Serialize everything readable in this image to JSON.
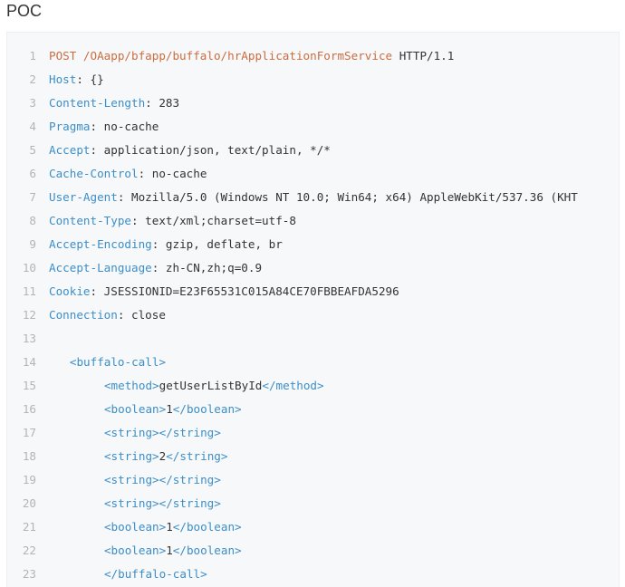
{
  "heading": "POC",
  "colors": {
    "method": "#cb6d3e",
    "key": "#3d8ec7",
    "text": "#333333",
    "line_number": "#b4b4b4",
    "background": "#f6f8fa"
  },
  "code": {
    "lines": [
      {
        "number": "1",
        "indent": 0,
        "parts": [
          {
            "t": "kw",
            "v": "POST /OAapp/bfapp/buffalo/hrApplicationFormService"
          },
          {
            "t": "txt",
            "v": " HTTP/1.1"
          }
        ]
      },
      {
        "number": "2",
        "indent": 0,
        "parts": [
          {
            "t": "hdr",
            "v": "Host"
          },
          {
            "t": "txt",
            "v": ": {}"
          }
        ]
      },
      {
        "number": "3",
        "indent": 0,
        "parts": [
          {
            "t": "hdr",
            "v": "Content-Length"
          },
          {
            "t": "txt",
            "v": ": 283"
          }
        ]
      },
      {
        "number": "4",
        "indent": 0,
        "parts": [
          {
            "t": "hdr",
            "v": "Pragma"
          },
          {
            "t": "txt",
            "v": ": no-cache"
          }
        ]
      },
      {
        "number": "5",
        "indent": 0,
        "parts": [
          {
            "t": "hdr",
            "v": "Accept"
          },
          {
            "t": "txt",
            "v": ": application/json, text/plain, */*"
          }
        ]
      },
      {
        "number": "6",
        "indent": 0,
        "parts": [
          {
            "t": "hdr",
            "v": "Cache-Control"
          },
          {
            "t": "txt",
            "v": ": no-cache"
          }
        ]
      },
      {
        "number": "7",
        "indent": 0,
        "parts": [
          {
            "t": "hdr",
            "v": "User-Agent"
          },
          {
            "t": "txt",
            "v": ": Mozilla/5.0 (Windows NT 10.0; Win64; x64) AppleWebKit/537.36 (KHT"
          }
        ]
      },
      {
        "number": "8",
        "indent": 0,
        "parts": [
          {
            "t": "hdr",
            "v": "Content-Type"
          },
          {
            "t": "txt",
            "v": ": text/xml;charset=utf-8"
          }
        ]
      },
      {
        "number": "9",
        "indent": 0,
        "parts": [
          {
            "t": "hdr",
            "v": "Accept-Encoding"
          },
          {
            "t": "txt",
            "v": ": gzip, deflate, br"
          }
        ]
      },
      {
        "number": "10",
        "indent": 0,
        "parts": [
          {
            "t": "hdr",
            "v": "Accept-Language"
          },
          {
            "t": "txt",
            "v": ": zh-CN,zh;q=0.9"
          }
        ]
      },
      {
        "number": "11",
        "indent": 0,
        "parts": [
          {
            "t": "hdr",
            "v": "Cookie"
          },
          {
            "t": "txt",
            "v": ": JSESSIONID=E23F65531C015A84CE70FBBEAFDA5296"
          }
        ]
      },
      {
        "number": "12",
        "indent": 0,
        "parts": [
          {
            "t": "hdr",
            "v": "Connection"
          },
          {
            "t": "txt",
            "v": ": close"
          }
        ]
      },
      {
        "number": "13",
        "indent": 0,
        "parts": []
      },
      {
        "number": "14",
        "indent": 3,
        "parts": [
          {
            "t": "tag",
            "v": "<buffalo-call>"
          }
        ]
      },
      {
        "number": "15",
        "indent": 8,
        "parts": [
          {
            "t": "tag",
            "v": "<method>"
          },
          {
            "t": "txt",
            "v": "getUserListById"
          },
          {
            "t": "tag",
            "v": "</method>"
          }
        ]
      },
      {
        "number": "16",
        "indent": 8,
        "parts": [
          {
            "t": "tag",
            "v": "<boolean>"
          },
          {
            "t": "txt",
            "v": "1"
          },
          {
            "t": "tag",
            "v": "</boolean>"
          }
        ]
      },
      {
        "number": "17",
        "indent": 8,
        "parts": [
          {
            "t": "tag",
            "v": "<string></string>"
          }
        ]
      },
      {
        "number": "18",
        "indent": 8,
        "parts": [
          {
            "t": "tag",
            "v": "<string>"
          },
          {
            "t": "txt",
            "v": "2"
          },
          {
            "t": "tag",
            "v": "</string>"
          }
        ]
      },
      {
        "number": "19",
        "indent": 8,
        "parts": [
          {
            "t": "tag",
            "v": "<string></string>"
          }
        ]
      },
      {
        "number": "20",
        "indent": 8,
        "parts": [
          {
            "t": "tag",
            "v": "<string></string>"
          }
        ]
      },
      {
        "number": "21",
        "indent": 8,
        "parts": [
          {
            "t": "tag",
            "v": "<boolean>"
          },
          {
            "t": "txt",
            "v": "1"
          },
          {
            "t": "tag",
            "v": "</boolean>"
          }
        ]
      },
      {
        "number": "22",
        "indent": 8,
        "parts": [
          {
            "t": "tag",
            "v": "<boolean>"
          },
          {
            "t": "txt",
            "v": "1"
          },
          {
            "t": "tag",
            "v": "</boolean>"
          }
        ]
      },
      {
        "number": "23",
        "indent": 8,
        "parts": [
          {
            "t": "tag",
            "v": "</buffalo-call>"
          }
        ]
      }
    ]
  }
}
